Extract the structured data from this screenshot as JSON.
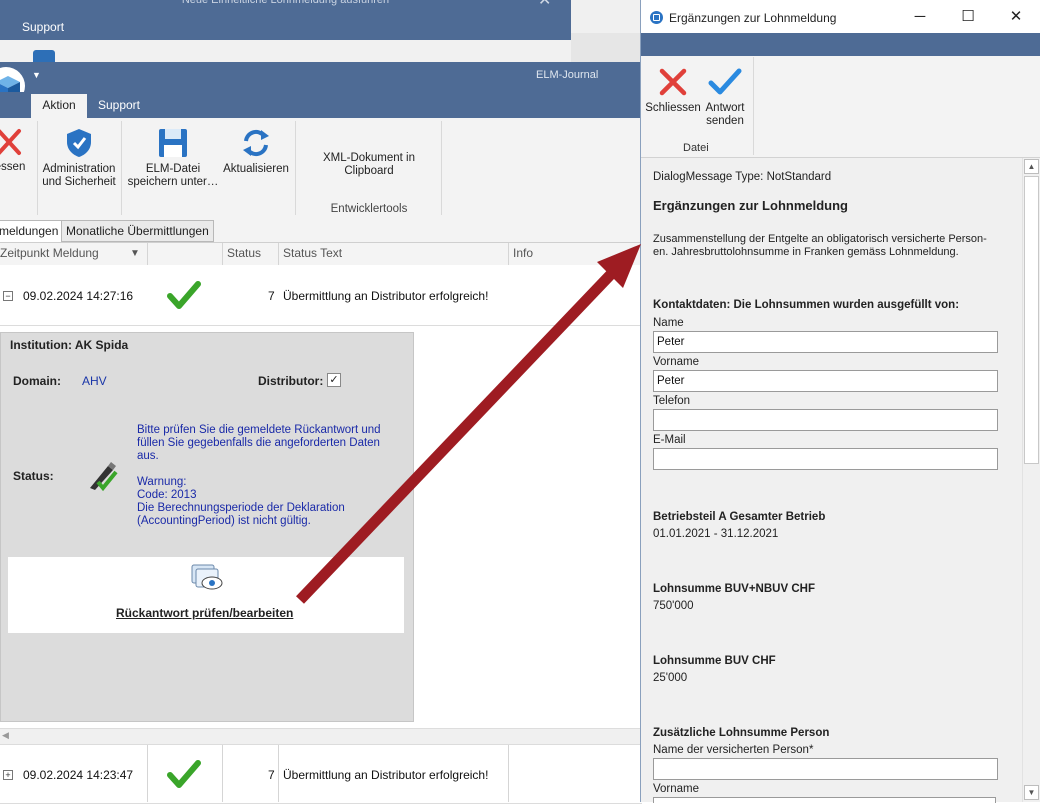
{
  "background_window": {
    "title": "Neue Einheitliche Lohnmeldung ausführen",
    "support_tab": "Support"
  },
  "main_window": {
    "title": "ELM-Journal",
    "tabs": [
      "Aktion",
      "Support"
    ],
    "ribbon": {
      "close_label": "essen",
      "admin_label": "Administration und Sicherheit",
      "save_label": "ELM-Datei speichern unter…",
      "refresh_label": "Aktualisieren",
      "xml_label": "XML-Dokument in Clipboard",
      "devtools_group": "Entwicklertools"
    },
    "subtabs": [
      "meldungen",
      "Monatliche Übermittlungen"
    ],
    "columns": [
      "Zeitpunkt Meldung",
      "",
      "Status",
      "Status Text",
      "Info"
    ],
    "rows": [
      {
        "expander": "−",
        "timestamp": "09.02.2024 14:27:16",
        "status": "7",
        "status_text": "Übermittlung an Distributor erfolgreich!"
      },
      {
        "expander": "+",
        "timestamp": "09.02.2024 14:23:47",
        "status": "7",
        "status_text": "Übermittlung an Distributor erfolgreich!"
      }
    ],
    "detail": {
      "institution": "Institution: AK Spida",
      "domain_label": "Domain:",
      "domain_value": "AHV",
      "distributor_label": "Distributor:",
      "distributor_checked": "✓",
      "status_label": "Status:",
      "status_lines": [
        "Bitte prüfen Sie  die gemeldete Rückantwort und füllen Sie gegebenfalls die angeforderten Daten aus.",
        "",
        "Warnung:",
        "Code: 2013",
        "Die Berechnungsperiode der Deklaration (AccountingPeriod) ist nicht gültig."
      ],
      "link_label": "Rückantwort prüfen/bearbeiten"
    }
  },
  "dialog": {
    "title": "Ergänzungen zur Lohnmeldung",
    "ribbon": {
      "close_label_1": "Schliessen",
      "send_label_1": "Antwort",
      "send_label_2": "senden",
      "group_label": "Datei"
    },
    "message_type": "DialogMessage Type: NotStandard",
    "heading": "Ergänzungen zur Lohnmeldung",
    "description_1": "Zusammenstellung der Entgelte an obligatorisch versicherte Person-",
    "description_2": "en. Jahresbruttolohnsumme in Franken gemäss Lohnmeldung.",
    "contact_heading": "Kontaktdaten: Die Lohnsummen wurden ausgefüllt von:",
    "fields": {
      "name_label": "Name",
      "name_value": "Peter",
      "vorname_label": "Vorname",
      "vorname_value": "Peter",
      "telefon_label": "Telefon",
      "telefon_value": "",
      "email_label": "E-Mail",
      "email_value": ""
    },
    "betriebsteil_heading": "Betriebsteil A Gesamter Betrieb",
    "betriebsteil_period": "01.01.2021 - 31.12.2021",
    "buv_nbuv_heading": "Lohnsumme BUV+NBUV CHF",
    "buv_nbuv_value": "750'000",
    "buv_heading": "Lohnsumme BUV CHF",
    "buv_value": "25'000",
    "extra_heading": "Zusätzliche Lohnsumme Person",
    "insured_name_label": "Name der versicherten Person*",
    "insured_name_value": "",
    "insured_vorname_label": "Vorname"
  },
  "colors": {
    "titlebar": "#4e6b95",
    "accent_blue": "#2a73c3",
    "close_red": "#e0403a",
    "check_green": "#3aa52a",
    "arrow_red": "#9e1c22",
    "link_blue": "#1a2aa8"
  }
}
